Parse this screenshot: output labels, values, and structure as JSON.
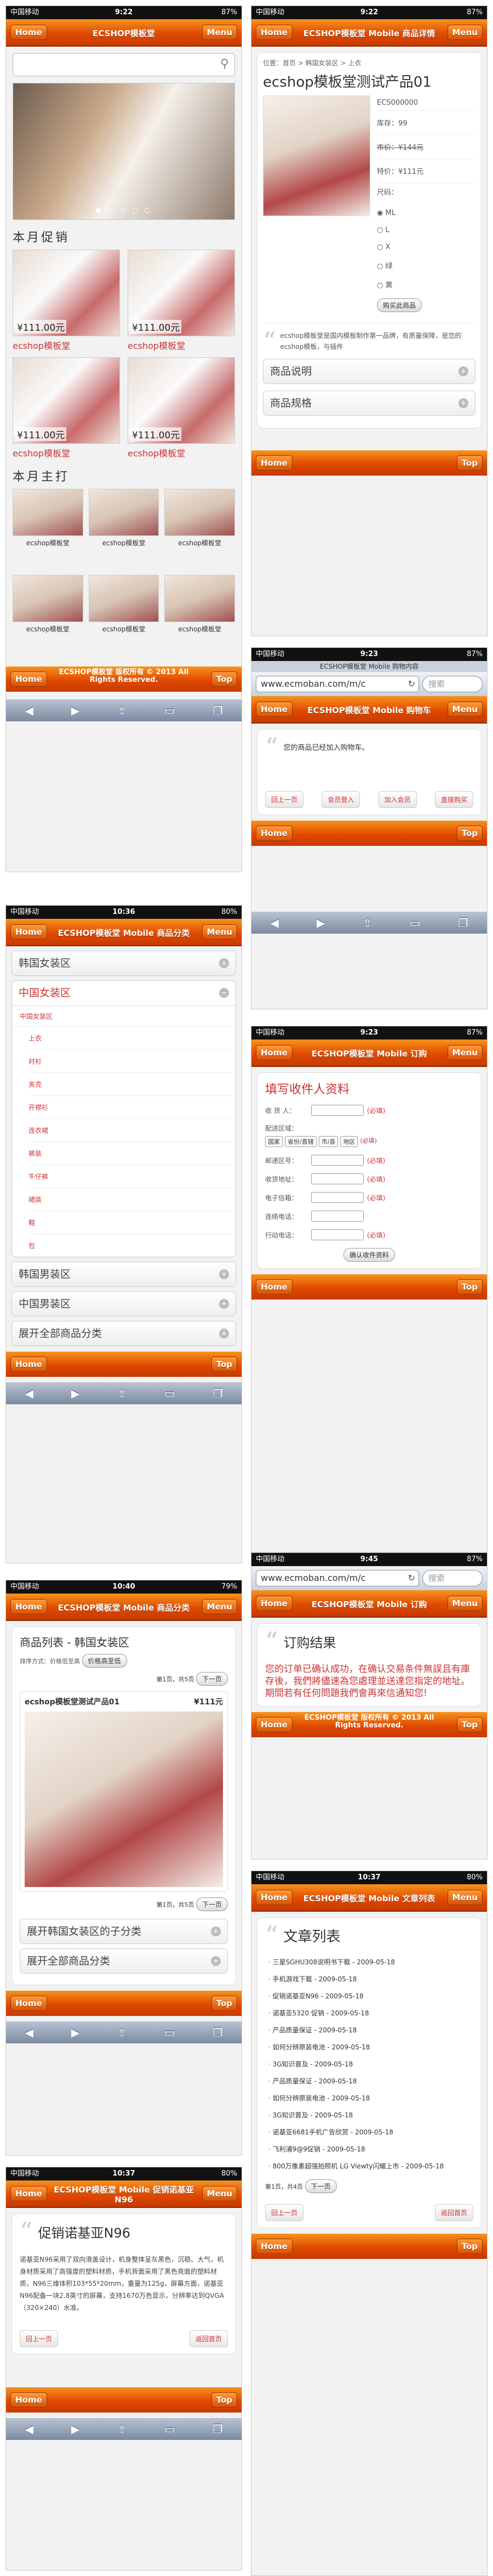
{
  "status": {
    "carrier": "中国移动",
    "wifi": "wifi-icon",
    "battery_87": "87%",
    "battery_80": "80%",
    "battery_79": "79%",
    "time_922": "9:22",
    "time_923": "9:23",
    "time_945": "9:45",
    "time_1036": "10:36",
    "time_1037": "10:37",
    "time_1040": "10:40"
  },
  "header": {
    "home": "Home",
    "menu": "Menu",
    "top": "Top",
    "title_shop": "ECSHOP模板堂",
    "title_product": "ECSHOP模板堂 Mobile 商品详情",
    "title_cart": "ECSHOP模板堂 Mobile 购物车",
    "title_cat": "ECSHOP模板堂 Mobile 商品分类",
    "title_list": "ECSHOP模板堂 Mobile 商品分类",
    "title_order": "ECSHOP模板堂 Mobile 订购",
    "title_article": "ECSHOP模板堂 Mobile 文章列表",
    "title_n96": "ECSHOP模板堂 Mobile 促销诺基亚N96",
    "browser_title_cart": "ECSHOP模板堂 Mobile 购物内容"
  },
  "footer": {
    "copy": "ECSHOP模板堂 版权所有 © 2013 All Rights Reserved."
  },
  "browser": {
    "url": "www.ecmoban.com/m/c",
    "search": "搜索"
  },
  "home": {
    "section_promo": "本月促销",
    "section_hot": "本月主打",
    "promo": [
      {
        "price": "¥111.00元",
        "name": "ecshop模板堂"
      },
      {
        "price": "¥111.00元",
        "name": "ecshop模板堂"
      },
      {
        "price": "¥111.00元",
        "name": "ecshop模板堂"
      },
      {
        "price": "¥111.00元",
        "name": "ecshop模板堂"
      }
    ],
    "hot": [
      "ecshop模板堂",
      "ecshop模板堂",
      "ecshop模板堂",
      "ecshop模板堂",
      "ecshop模板堂",
      "ecshop模板堂"
    ]
  },
  "product": {
    "breadcrumb": "位置：首页 > 韩国女装区 > 上衣",
    "name": "ecshop模板堂测试产品01",
    "sn": "ECS000000",
    "stock": "库存：99",
    "market": "市价：¥144元",
    "sale": "特价：¥111元",
    "size_label": "尺码：",
    "sizes": [
      "ML",
      "L",
      "X",
      "绿",
      "黄"
    ],
    "cart_btn": "购买此商品",
    "desc": "ecshop模板堂是国内模板制作第一品牌，有质量保障，是您的ecshop模板，与插件",
    "acc1": "商品说明",
    "acc2": "商品规格"
  },
  "cart": {
    "empty": "您的商品已经加入购物车。",
    "btns": [
      "回上一页",
      "会员登入",
      "加入会员",
      "直接购买"
    ]
  },
  "category": {
    "a1": "韩国女装区",
    "a1_open": "中国女装区",
    "sub_head": "中国女装区",
    "subs": [
      "上衣",
      "衬衫",
      "夹克",
      "开襟衫",
      "连衣裙",
      "裤装",
      "牛仔裤",
      "裙装",
      "鞋",
      "包"
    ],
    "a2": "韩国男装区",
    "a3": "中国男装区",
    "a4": "展开全部商品分类"
  },
  "address": {
    "title": "填写收件人资料",
    "name": "收 货 人：",
    "req": "(必填)",
    "region": "配送区域：",
    "country": "国家",
    "prov": "省份/直辖",
    "city": "市/县",
    "dist": "地区",
    "zip": "邮递区号：",
    "addr": "收货地址：",
    "mail": "电子信箱：",
    "tel": "连络电话：",
    "mobile": "行动电话：",
    "save": "确认收件资料"
  },
  "list": {
    "title": "商品列表 - 韩国女装区",
    "sort": "排序方式：价格低至高",
    "sort_btn": "价格高至低",
    "page": "第1页，共5页",
    "next": "下一页",
    "item": "ecshop模板堂测试产品01",
    "price": "¥111元",
    "more": "展开韩国女装区的子分类",
    "all": "展开全部商品分类"
  },
  "order": {
    "title": "订购结果",
    "msg": "您的订单已确认成功，在确认交易条件無誤且有庫存後，我們將儘速為您處理並送達您指定的地址。期間若有任何問題我們會再來信通知您!"
  },
  "n96": {
    "title": "促销诺基亚N96",
    "body": "诺基亚N96采用了双向滑盖设计，机身整体呈灰黑色，沉稳、大气，机身材质采用了高强度的塑料材质，手机背面采用了黑色亮面的塑料材质，N96三维体积103*55*20mm，重量为125g，屏幕方面，诺基亚N96配备一块2.8英寸的屏幕，支持1670万色显示，分辨率达到QVGA（320×240）水准。",
    "prev": "回上一页",
    "back": "返回首页"
  },
  "articles": {
    "title": "文章列表",
    "items": [
      "三星SGHU308说明书下载 - 2009-05-18",
      "手机游戏下载 - 2009-05-18",
      "促销诺基亚N96 - 2009-05-18",
      "诺基亚5320 促销 - 2009-05-18",
      "产品质量保证 - 2009-05-18",
      "如何分辨原装电池 - 2009-05-18",
      "3G知识普及 - 2009-05-18",
      "产品质量保证 - 2009-05-18",
      "如何分辨原装电池 - 2009-05-18",
      "3G知识普及 - 2009-05-18",
      "诺基亚6681手机广告欣赏 - 2009-05-18",
      "飞利浦9@9促销 - 2009-05-18",
      "800万像素超强拍照机 LG Viewty闪耀上市 - 2009-05-18"
    ],
    "page": "第1页，共4页",
    "next": "下一页",
    "prev": "回上一页",
    "back": "返回首页"
  },
  "colors": {
    "accent": "#e04a00",
    "link": "#cc3333"
  }
}
